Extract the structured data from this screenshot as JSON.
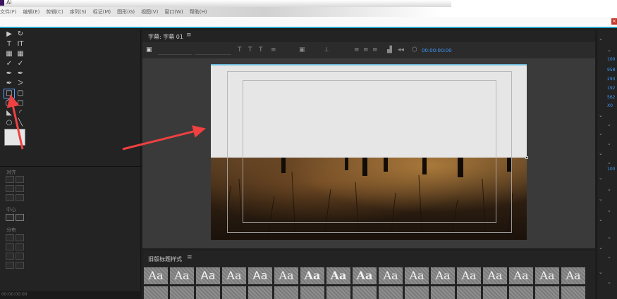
{
  "app": {
    "title": "Ai"
  },
  "menubar": [
    "文件(F)",
    "编辑(E)",
    "剪辑(C)",
    "序列(S)",
    "标记(M)",
    "图形(G)",
    "视图(V)",
    "窗口(W)",
    "帮助(H)"
  ],
  "window": {
    "close_label": "×"
  },
  "tools": {
    "icons": [
      "selection-tool-icon",
      "rotate-tool-icon",
      "type-tool-icon",
      "vertical-type-tool-icon",
      "area-type-tool-icon",
      "vertical-area-type-tool-icon",
      "path-type-tool-icon",
      "vertical-path-type-tool-icon",
      "pen-tool-icon",
      "delete-anchor-tool-icon",
      "add-anchor-tool-icon",
      "convert-anchor-tool-icon",
      "rectangle-tool-icon",
      "rounded-rectangle-tool-icon",
      "clipped-corner-tool-icon",
      "rounded-corner-tool-icon",
      "wedge-tool-icon",
      "arc-tool-icon",
      "ellipse-tool-icon",
      "line-tool-icon"
    ],
    "glyphs": [
      "▶",
      "↻",
      "T",
      "IT",
      "▦",
      "▦",
      "✓",
      "✓",
      "✒",
      "✒",
      "✒",
      "ᐳ",
      "□",
      "▢",
      "◯",
      "▢",
      "◣",
      "◜",
      "○",
      "╲"
    ],
    "section_align": "对齐",
    "section_center": "中心",
    "section_distribute": "分布"
  },
  "editor": {
    "tab_title": "字幕: 字幕 01",
    "tab_menu": "≡",
    "timecode": "00:00:00:00",
    "toolbar_icons": [
      "T",
      "T",
      "T",
      "≡",
      "▣",
      "⟂",
      "≡",
      "≡",
      "≡",
      "▟",
      "◂◂",
      "⬡"
    ]
  },
  "styles_panel": {
    "title": "旧版标题样式",
    "menu": "≡",
    "swatches": [
      "Aa",
      "Aa",
      "Aa",
      "Aa",
      "Aa",
      "Aa",
      "Aa",
      "Aa",
      "Aa",
      "Aa",
      "Aa",
      "Aa",
      "Aa",
      "Aa",
      "Aa",
      "Aa",
      "Aa"
    ]
  },
  "right_panel": {
    "values": [
      "100",
      "958",
      "293",
      "192",
      "562",
      "X0",
      "100"
    ]
  },
  "bottom": {
    "timecode": "00:00:00:00"
  },
  "colors": {
    "accent": "#2aa5c8",
    "timecode": "#3d9bff",
    "annotation_arrow": "#f04040",
    "rect_fill": "#e6e6e6"
  }
}
